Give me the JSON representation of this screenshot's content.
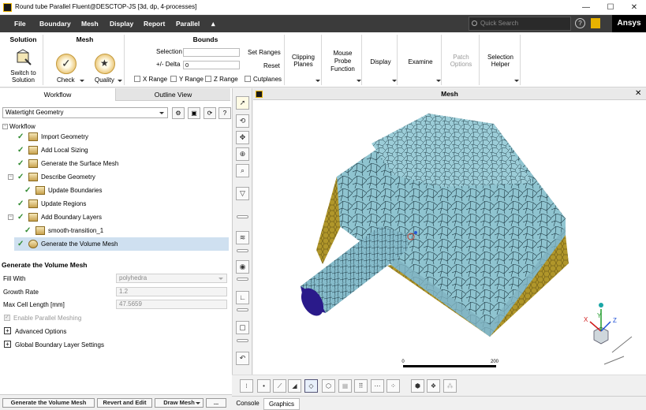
{
  "window": {
    "title": "Round tube Parallel Fluent@DESCTOP-JS  [3d, dp, 4-processes]",
    "minimize_glyph": "—",
    "maximize_glyph": "☐",
    "close_glyph": "✕"
  },
  "menubar": {
    "items": [
      "File",
      "Boundary",
      "Mesh",
      "Display",
      "Report",
      "Parallel"
    ],
    "quick_search_placeholder": "Quick Search",
    "help_glyph": "?",
    "brand": "Ansys"
  },
  "ribbon": {
    "solution": {
      "header": "Solution",
      "switch_label_1": "Switch to",
      "switch_label_2": "Solution"
    },
    "mesh": {
      "header": "Mesh",
      "check_label": "Check",
      "quality_label": "Quality"
    },
    "bounds": {
      "header": "Bounds",
      "selection_label": "Selection",
      "selection_value": "",
      "delta_label": "+/- Delta",
      "delta_value": "0",
      "set_ranges": "Set Ranges",
      "reset": "Reset",
      "x_range": "X Range",
      "y_range": "Y Range",
      "z_range": "Z Range",
      "cutplanes": "Cutplanes"
    },
    "clipping_planes_1": "Clipping",
    "clipping_planes_2": "Planes",
    "mouse_probe_1": "Mouse",
    "mouse_probe_2": "Probe",
    "mouse_probe_3": "Function",
    "display": "Display",
    "examine": "Examine",
    "patch_options_1": "Patch",
    "patch_options_2": "Options",
    "selection_helper_1": "Selection",
    "selection_helper_2": "Helper"
  },
  "left_panel": {
    "tabs": [
      "Workflow",
      "Outline View"
    ],
    "workflow_type": "Watertight Geometry",
    "workflow_root": "Workflow",
    "tasks": [
      {
        "label": "Import Geometry",
        "done": true
      },
      {
        "label": "Add Local Sizing",
        "done": true
      },
      {
        "label": "Generate the Surface Mesh",
        "done": true
      },
      {
        "label": "Describe Geometry",
        "done": true
      },
      {
        "label": "Update Boundaries",
        "done": true
      },
      {
        "label": "Update Regions",
        "done": true
      },
      {
        "label": "Add Boundary Layers",
        "done": true
      },
      {
        "label": "smooth-transition_1",
        "done": true
      },
      {
        "label": "Generate the Volume Mesh",
        "done": true
      }
    ],
    "section_title": "Generate the Volume Mesh",
    "fill_with_label": "Fill With",
    "fill_with_value": "polyhedra",
    "growth_rate_label": "Growth Rate",
    "growth_rate_value": "1.2",
    "max_cell_label": "Max Cell Length [mm]",
    "max_cell_value": "47.5659",
    "parallel_meshing_label": "Enable Parallel Meshing",
    "advanced_options": "Advanced Options",
    "global_bl_settings": "Global Boundary Layer Settings",
    "buttons": [
      "Generate the Volume Mesh",
      "Revert and Edit",
      "Draw Mesh",
      "..."
    ]
  },
  "viewport": {
    "title": "Mesh",
    "scale_min": "0",
    "scale_max": "200",
    "triad_x": "X",
    "triad_y": "Y",
    "triad_z": "Z"
  },
  "bottom_tabs": [
    "Console",
    "Graphics"
  ],
  "colors": {
    "menubar": "#3b3b3b",
    "mesh_surface": "#8fc4d0",
    "mesh_edges": "#1e3a44",
    "block_side": "#b0962a",
    "tube_end": "#2a1a8a",
    "check_green": "#2f8a2f",
    "selected_row": "#cfe0f0"
  }
}
